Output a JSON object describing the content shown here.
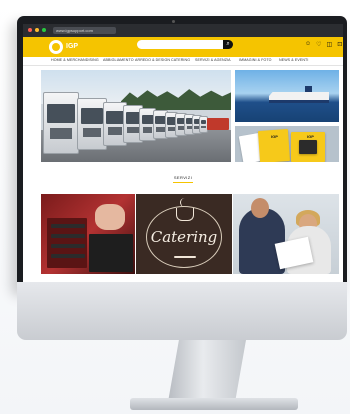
{
  "browser": {
    "url": "www.igpsupport.com"
  },
  "header": {
    "logo_text": "IGP",
    "search_placeholder": "",
    "icons": [
      "user-icon",
      "heart-icon",
      "bag-icon",
      "cart-icon"
    ]
  },
  "nav": {
    "items": [
      "HOME & MERCHANDISING",
      "ABBIGLIAMENTO",
      "ARREDO & DESIGN",
      "CATERING",
      "SERVIZI & AGENZIA",
      "IMMAGINI & FOTO",
      "NEWS & EVENTI"
    ]
  },
  "section": {
    "title": "SERVIZI"
  },
  "tiles": {
    "catering_text": "Catering"
  },
  "colors": {
    "brand": "#f5c400",
    "bezel": "#1a1c20",
    "catering_bg": "#3a2a23"
  }
}
